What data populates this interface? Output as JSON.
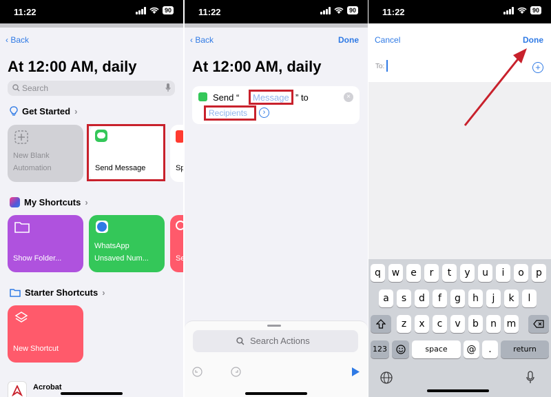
{
  "status": {
    "time": "11:22",
    "battery": "90"
  },
  "panel1": {
    "back": "Back",
    "title": "At 12:00 AM, daily",
    "search_placeholder": "Search",
    "get_started": "Get Started",
    "tiles": {
      "new_blank_line1": "New Blank",
      "new_blank_line2": "Automation",
      "send_message": "Send Message",
      "partial": "Sp"
    },
    "my_shortcuts": "My Shortcuts",
    "shortcuts": {
      "show_folder": "Show Folder...",
      "whatsapp_line1": "WhatsApp",
      "whatsapp_line2": "Unsaved Num...",
      "partial": "Se"
    },
    "starter_shortcuts": "Starter Shortcuts",
    "new_shortcut": "New Shortcut",
    "app_name": "Acrobat"
  },
  "panel2": {
    "back": "Back",
    "done": "Done",
    "title": "At 12:00 AM, daily",
    "action": {
      "send": "Send “",
      "message_token": "Message",
      "to": "” to",
      "recipients_token": "Recipients"
    },
    "search_actions": "Search Actions"
  },
  "panel3": {
    "cancel": "Cancel",
    "done": "Done",
    "to_label": "To:",
    "keyboard": {
      "row1": [
        "q",
        "w",
        "e",
        "r",
        "t",
        "y",
        "u",
        "i",
        "o",
        "p"
      ],
      "row2": [
        "a",
        "s",
        "d",
        "f",
        "g",
        "h",
        "j",
        "k",
        "l"
      ],
      "row3": [
        "z",
        "x",
        "c",
        "v",
        "b",
        "n",
        "m"
      ],
      "num_key": "123",
      "space": "space",
      "at": "@",
      "dot": ".",
      "return": "return"
    }
  },
  "colors": {
    "accent": "#2f7ae5",
    "highlight_box": "#c8212c",
    "tile_gray": "#d1d1d6",
    "tile_purple": "#af52de",
    "tile_green": "#34c759",
    "tile_red": "#ff5a6b",
    "keyboard_bg": "#d1d4d9"
  }
}
